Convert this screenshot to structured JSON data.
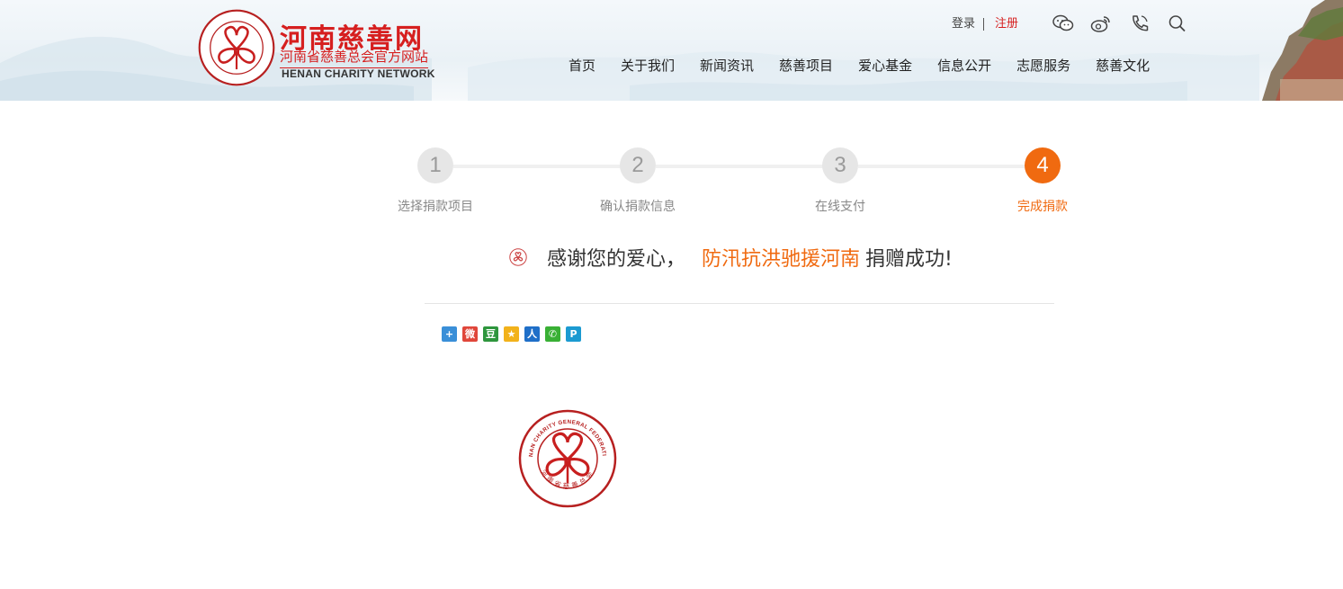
{
  "header": {
    "logo": {
      "cn_title": "河南慈善网",
      "cn_subtitle": "河南省慈善总会官方网站",
      "en_subtitle": "HENAN CHARITY NETWORK",
      "emblem_text_en": "HENAN CHARITY GENERAL FEDERATION",
      "emblem_text_cn": "河南省慈善总会"
    },
    "login_label": "登录",
    "register_label": "注册",
    "icons": [
      "wechat-icon",
      "weibo-icon",
      "phone-icon",
      "search-icon"
    ],
    "nav": [
      "首页",
      "关于我们",
      "新闻资讯",
      "慈善项目",
      "爱心基金",
      "信息公开",
      "志愿服务",
      "慈善文化"
    ]
  },
  "steps": [
    {
      "number": "1",
      "label": "选择捐款项目"
    },
    {
      "number": "2",
      "label": "确认捐款信息"
    },
    {
      "number": "3",
      "label": "在线支付"
    },
    {
      "number": "4",
      "label": "完成捐款"
    }
  ],
  "active_step": 4,
  "success": {
    "prefix": "感谢您的爱心，",
    "project": "防汛抗洪驰援河南",
    "suffix": "捐赠成功!"
  },
  "share_icons": [
    {
      "name": "share-more-icon",
      "glyph": "+",
      "color": "#3a8fd8"
    },
    {
      "name": "share-weibo-icon",
      "glyph": "微",
      "color": "#e0463a"
    },
    {
      "name": "share-douban-icon",
      "glyph": "豆",
      "color": "#2e963d"
    },
    {
      "name": "share-qzone-icon",
      "glyph": "★",
      "color": "#f2b21b"
    },
    {
      "name": "share-renren-icon",
      "glyph": "人",
      "color": "#1f6fc8"
    },
    {
      "name": "share-wechat-icon",
      "glyph": "✆",
      "color": "#39b035"
    },
    {
      "name": "share-print-icon",
      "glyph": "P",
      "color": "#1b9ad1"
    }
  ],
  "colors": {
    "brand_red": "#d61f1f",
    "accent_orange": "#f06a10",
    "step_inactive": "#e6e6e6"
  }
}
